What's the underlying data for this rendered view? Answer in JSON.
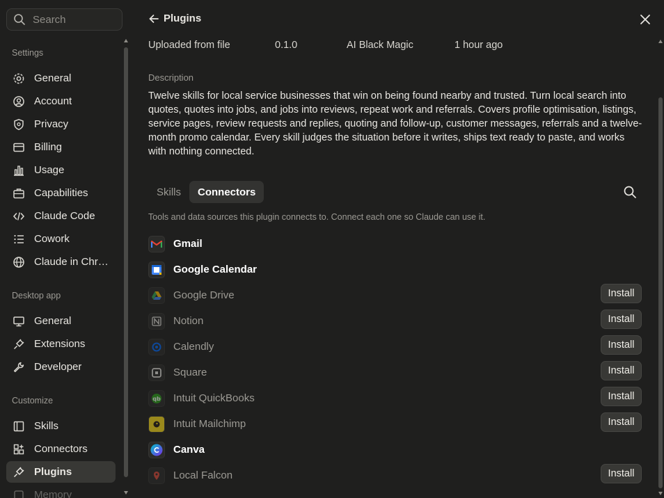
{
  "sidebar": {
    "search_placeholder": "Search",
    "sections": [
      {
        "label": "Settings"
      },
      {
        "label": "Desktop app"
      },
      {
        "label": "Customize"
      }
    ],
    "settings_items": [
      {
        "label": "General",
        "icon": "gear-icon"
      },
      {
        "label": "Account",
        "icon": "account-icon"
      },
      {
        "label": "Privacy",
        "icon": "shield-icon"
      },
      {
        "label": "Billing",
        "icon": "billing-icon"
      },
      {
        "label": "Usage",
        "icon": "bar-chart-icon"
      },
      {
        "label": "Capabilities",
        "icon": "briefcase-icon"
      },
      {
        "label": "Claude Code",
        "icon": "code-icon"
      },
      {
        "label": "Cowork",
        "icon": "list-icon"
      },
      {
        "label": "Claude in Chr…",
        "icon": "globe-icon"
      }
    ],
    "desktop_items": [
      {
        "label": "General",
        "icon": "monitor-icon"
      },
      {
        "label": "Extensions",
        "icon": "plug-icon"
      },
      {
        "label": "Developer",
        "icon": "wrench-icon"
      }
    ],
    "customize_items": [
      {
        "label": "Skills",
        "icon": "book-icon"
      },
      {
        "label": "Connectors",
        "icon": "grid-plus-icon"
      },
      {
        "label": "Plugins",
        "icon": "plug-icon",
        "active": true
      },
      {
        "label": "Memory",
        "icon": "memory-icon"
      }
    ]
  },
  "header": {
    "title": "Plugins"
  },
  "meta": {
    "source": "Uploaded from file",
    "version": "0.1.0",
    "author": "AI Black Magic",
    "updated": "1 hour ago"
  },
  "description": {
    "label": "Description",
    "text": "Twelve skills for local service businesses that win on being found nearby and trusted. Turn local search into quotes, quotes into jobs, and jobs into reviews, repeat work and referrals. Covers profile optimisation, listings, service pages, review requests and replies, quoting and follow-up, customer messages, referrals and a twelve-month promo calendar. Every skill judges the situation before it writes, ships text ready to paste, and works with nothing connected."
  },
  "tabs": [
    {
      "label": "Skills",
      "active": false
    },
    {
      "label": "Connectors",
      "active": true
    }
  ],
  "hint": "Tools and data sources this plugin connects to. Connect each one so Claude can use it.",
  "install_label": "Install",
  "connectors": [
    {
      "name": "Gmail",
      "connected": true,
      "icon": "gmail-icon"
    },
    {
      "name": "Google Calendar",
      "connected": true,
      "icon": "google-calendar-icon"
    },
    {
      "name": "Google Drive",
      "connected": false,
      "icon": "google-drive-icon"
    },
    {
      "name": "Notion",
      "connected": false,
      "icon": "notion-icon"
    },
    {
      "name": "Calendly",
      "connected": false,
      "icon": "calendly-icon"
    },
    {
      "name": "Square",
      "connected": false,
      "icon": "square-icon"
    },
    {
      "name": "Intuit QuickBooks",
      "connected": false,
      "icon": "quickbooks-icon"
    },
    {
      "name": "Intuit Mailchimp",
      "connected": false,
      "icon": "mailchimp-icon"
    },
    {
      "name": "Canva",
      "connected": true,
      "icon": "canva-icon"
    },
    {
      "name": "Local Falcon",
      "connected": false,
      "icon": "local-falcon-icon"
    }
  ]
}
